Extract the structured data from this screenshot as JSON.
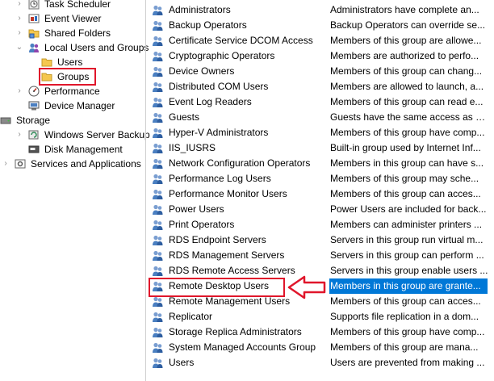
{
  "tree": [
    {
      "id": "task-scheduler",
      "label": "Task Scheduler",
      "chev": "›",
      "icon": "clock-icon"
    },
    {
      "id": "event-viewer",
      "label": "Event Viewer",
      "chev": "›",
      "icon": "event-viewer-icon"
    },
    {
      "id": "shared-folders",
      "label": "Shared Folders",
      "chev": "›",
      "icon": "shared-folder-icon"
    },
    {
      "id": "local-users-groups",
      "label": "Local Users and Groups",
      "chev": "⌄",
      "icon": "users-groups-icon"
    },
    {
      "id": "users",
      "label": "Users",
      "chev": "",
      "icon": "folder-icon"
    },
    {
      "id": "groups",
      "label": "Groups",
      "chev": "",
      "icon": "folder-icon"
    },
    {
      "id": "performance",
      "label": "Performance",
      "chev": "›",
      "icon": "performance-icon"
    },
    {
      "id": "device-manager",
      "label": "Device Manager",
      "chev": "",
      "icon": "device-manager-icon"
    },
    {
      "id": "storage",
      "label": "Storage",
      "chev": "⌄",
      "icon": "storage-icon"
    },
    {
      "id": "windows-server-backup",
      "label": "Windows Server Backup",
      "chev": "›",
      "icon": "backup-icon"
    },
    {
      "id": "disk-management",
      "label": "Disk Management",
      "chev": "",
      "icon": "disk-icon"
    },
    {
      "id": "services-applications",
      "label": "Services and Applications",
      "chev": "›",
      "icon": "services-icon"
    }
  ],
  "groups": [
    {
      "name": "Administrators",
      "description": "Administrators have complete an..."
    },
    {
      "name": "Backup Operators",
      "description": "Backup Operators can override se..."
    },
    {
      "name": "Certificate Service DCOM Access",
      "description": "Members of this group are allowe..."
    },
    {
      "name": "Cryptographic Operators",
      "description": "Members are authorized to perfo..."
    },
    {
      "name": "Device Owners",
      "description": "Members of this group can chang..."
    },
    {
      "name": "Distributed COM Users",
      "description": "Members are allowed to launch, a..."
    },
    {
      "name": "Event Log Readers",
      "description": "Members of this group can read e..."
    },
    {
      "name": "Guests",
      "description": "Guests have the same access as m..."
    },
    {
      "name": "Hyper-V Administrators",
      "description": "Members of this group have comp..."
    },
    {
      "name": "IIS_IUSRS",
      "description": "Built-in group used by Internet Inf..."
    },
    {
      "name": "Network Configuration Operators",
      "description": "Members in this group can have s..."
    },
    {
      "name": "Performance Log Users",
      "description": "Members of this group may sche..."
    },
    {
      "name": "Performance Monitor Users",
      "description": "Members of this group can acces..."
    },
    {
      "name": "Power Users",
      "description": "Power Users are included for back..."
    },
    {
      "name": "Print Operators",
      "description": "Members can administer printers ..."
    },
    {
      "name": "RDS Endpoint Servers",
      "description": "Servers in this group run virtual m..."
    },
    {
      "name": "RDS Management Servers",
      "description": "Servers in this group can perform ..."
    },
    {
      "name": "RDS Remote Access Servers",
      "description": "Servers in this group enable users ..."
    },
    {
      "name": "Remote Desktop Users",
      "description": "Members in this group are grante..."
    },
    {
      "name": "Remote Management Users",
      "description": "Members of this group can acces..."
    },
    {
      "name": "Replicator",
      "description": "Supports file replication in a dom..."
    },
    {
      "name": "Storage Replica Administrators",
      "description": "Members of this group have comp..."
    },
    {
      "name": "System Managed Accounts Group",
      "description": "Members of this group are mana..."
    },
    {
      "name": "Users",
      "description": "Users are prevented from making ..."
    }
  ],
  "selected_group": "Remote Desktop Users",
  "colors": {
    "selection": "#0078d7",
    "highlight_box": "#e0162b",
    "folder": "#f5c74f"
  }
}
